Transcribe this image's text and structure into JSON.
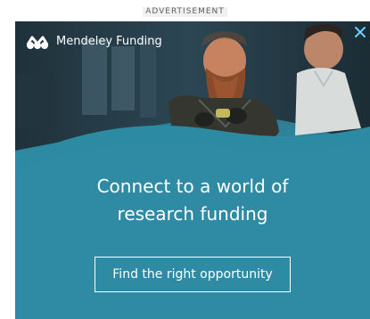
{
  "ad_label": "ADVERTISEMENT",
  "brand": {
    "name": "Mendeley Funding",
    "icon": "mendeley-logo-icon"
  },
  "close_icon": "close-icon",
  "headline": {
    "line1": "Connect to a world of",
    "line2": "research funding"
  },
  "cta_label": "Find the right opportunity",
  "colors": {
    "teal": "#2f8aa3",
    "deep_teal": "#1f6f86",
    "accent_cyan": "#63d2ff",
    "white": "#ffffff"
  }
}
